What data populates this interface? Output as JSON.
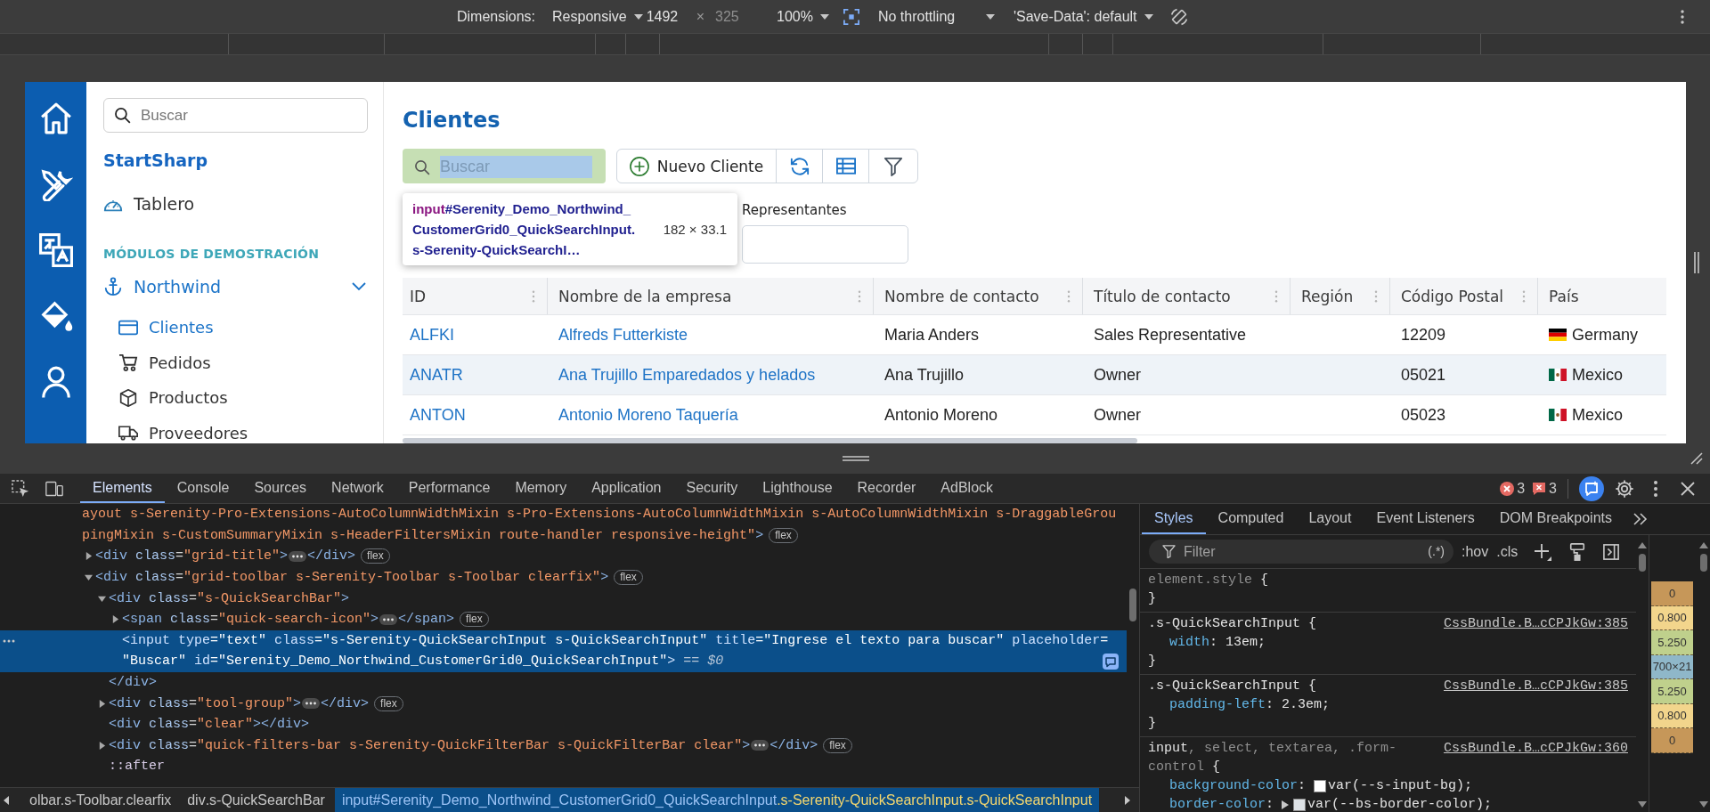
{
  "device_toolbar": {
    "dimensions_label": "Dimensions:",
    "preset": "Responsive",
    "width": {
      "value": "1492"
    },
    "times": "×",
    "height": {
      "placeholder": "325"
    },
    "zoom": "100%",
    "throttling": "No throttling",
    "save_data": "'Save-Data': default"
  },
  "sidebar": {
    "search": {
      "placeholder": "Buscar"
    },
    "brand": "StartSharp",
    "items": [
      {
        "kind": "gauge",
        "label": "Tablero",
        "selected": false
      }
    ],
    "section": "MÓDULOS DE DEMOSTRACIÓN",
    "module": {
      "label": "Northwind",
      "expanded": true,
      "children": [
        {
          "kind": "card",
          "label": "Clientes",
          "selected": true
        },
        {
          "kind": "cart",
          "label": "Pedidos",
          "selected": false
        },
        {
          "kind": "cube",
          "label": "Productos",
          "selected": false
        },
        {
          "kind": "truck",
          "label": "Proveedores",
          "selected": false
        }
      ]
    }
  },
  "page": {
    "title": "Clientes",
    "quick_search": {
      "placeholder": "Buscar"
    },
    "toolbar_buttons": [
      {
        "kind": "add",
        "label": "Nuevo Cliente"
      },
      {
        "kind": "refresh"
      },
      {
        "kind": "columns"
      },
      {
        "kind": "filter"
      }
    ],
    "inspect_tooltip": {
      "tag": "input",
      "selector": "#Serenity_Demo_Northwind_CustomerGrid0_QuickSearchInput.s-Serenity-QuickSearchI…",
      "size": "182 × 33.1"
    },
    "quick_filters": [
      {
        "label": "Representantes"
      }
    ],
    "grid": {
      "columns": [
        "ID",
        "Nombre de la empresa",
        "Nombre de contacto",
        "Título de contacto",
        "Región",
        "Código Postal",
        "País"
      ],
      "rows": [
        {
          "kind": "de",
          "id": "ALFKI",
          "company": "Alfreds Futterkiste",
          "contact": "Maria Anders",
          "contact_title": "Sales Representative",
          "postal_code": "12209",
          "country": "Germany"
        },
        {
          "kind": "mx",
          "id": "ANATR",
          "company": "Ana Trujillo Emparedados y helados",
          "contact": "Ana Trujillo",
          "contact_title": "Owner",
          "postal_code": "05021",
          "country": "Mexico"
        },
        {
          "kind": "mx",
          "id": "ANTON",
          "company": "Antonio Moreno Taquería",
          "contact": "Antonio Moreno",
          "contact_title": "Owner",
          "postal_code": "05023",
          "country": "Mexico"
        }
      ]
    }
  },
  "devtools": {
    "tabs": [
      {
        "label": "Elements",
        "selected": true
      },
      {
        "label": "Console",
        "selected": false
      },
      {
        "label": "Sources",
        "selected": false
      },
      {
        "label": "Network",
        "selected": false
      },
      {
        "label": "Performance",
        "selected": false
      },
      {
        "label": "Memory",
        "selected": false
      },
      {
        "label": "Application",
        "selected": false
      },
      {
        "label": "Security",
        "selected": false
      },
      {
        "label": "Lighthouse",
        "selected": false
      },
      {
        "label": "Recorder",
        "selected": false
      },
      {
        "label": "AdBlock",
        "selected": false
      }
    ],
    "errors": "3",
    "issues": "3",
    "tree": [
      {
        "selected": false,
        "lines": [
          [
            {
              "kind": "value",
              "text": "ayout s-Serenity-Pro-Extensions-AutoColumnWidthMixin s-Pro-Extensions-AutoColumnWidthMixin s-AutoColumnWidthMixin s-DraggableGrou"
            }
          ],
          [
            {
              "kind": "value",
              "text": "pingMixin s-CustomSummaryMixin s-HeaderFiltersMixin route-handler responsive-height\""
            },
            {
              "kind": "tag",
              "text": ">"
            }
          ]
        ],
        "badge": "flex",
        "children": [
          {
            "expanded": false,
            "selected": false,
            "lines": [
              [
                {
                  "kind": "tag",
                  "text": "<div"
                },
                {
                  "kind": "attr",
                  "text": " class"
                },
                {
                  "kind": "plain",
                  "text": "="
                },
                {
                  "kind": "value",
                  "text": "\"grid-title\""
                },
                {
                  "kind": "tag",
                  "text": ">"
                }
              ]
            ],
            "close": [
              {
                "kind": "tag",
                "text": "</div>"
              }
            ],
            "badge": "flex"
          },
          {
            "expanded": true,
            "selected": false,
            "lines": [
              [
                {
                  "kind": "tag",
                  "text": "<div"
                },
                {
                  "kind": "attr",
                  "text": " class"
                },
                {
                  "kind": "plain",
                  "text": "="
                },
                {
                  "kind": "value",
                  "text": "\"grid-toolbar s-Serenity-Toolbar s-Toolbar clearfix\""
                },
                {
                  "kind": "tag",
                  "text": ">"
                }
              ]
            ],
            "badge": "flex",
            "children": [
              {
                "expanded": true,
                "selected": false,
                "lines": [
                  [
                    {
                      "kind": "tag",
                      "text": "<div"
                    },
                    {
                      "kind": "attr",
                      "text": " class"
                    },
                    {
                      "kind": "plain",
                      "text": "="
                    },
                    {
                      "kind": "value",
                      "text": "\"s-QuickSearchBar\""
                    },
                    {
                      "kind": "tag",
                      "text": ">"
                    }
                  ]
                ],
                "children": [
                  {
                    "expanded": false,
                    "selected": false,
                    "lines": [
                      [
                        {
                          "kind": "tag",
                          "text": "<span"
                        },
                        {
                          "kind": "attr",
                          "text": " class"
                        },
                        {
                          "kind": "plain",
                          "text": "="
                        },
                        {
                          "kind": "value",
                          "text": "\"quick-search-icon\""
                        },
                        {
                          "kind": "tag",
                          "text": ">"
                        }
                      ]
                    ],
                    "close": [
                      {
                        "kind": "tag",
                        "text": "</span>"
                      }
                    ],
                    "badge": "flex"
                  },
                  {
                    "selected": true,
                    "lines": [
                      [
                        {
                          "kind": "tag",
                          "text": "<input"
                        },
                        {
                          "kind": "attr",
                          "text": " type"
                        },
                        {
                          "kind": "plain",
                          "text": "="
                        },
                        {
                          "kind": "value",
                          "text": "\"text\""
                        },
                        {
                          "kind": "attr",
                          "text": " class"
                        },
                        {
                          "kind": "plain",
                          "text": "="
                        },
                        {
                          "kind": "value",
                          "text": "\"s-Serenity-QuickSearchInput s-QuickSearchInput\""
                        },
                        {
                          "kind": "attr",
                          "text": " title"
                        },
                        {
                          "kind": "plain",
                          "text": "="
                        },
                        {
                          "kind": "value",
                          "text": "\"Ingrese el texto para buscar\""
                        },
                        {
                          "kind": "attr",
                          "text": " placeholder"
                        },
                        {
                          "kind": "plain",
                          "text": "="
                        }
                      ],
                      [
                        {
                          "kind": "value",
                          "text": "\"Buscar\""
                        },
                        {
                          "kind": "attr",
                          "text": " id"
                        },
                        {
                          "kind": "plain",
                          "text": "="
                        },
                        {
                          "kind": "value",
                          "text": "\"Serenity_Demo_Northwind_CustomerGrid0_QuickSearchInput\""
                        },
                        {
                          "kind": "tag",
                          "text": ">"
                        }
                      ]
                    ],
                    "console_ref": "== $0"
                  }
                ],
                "close": [
                  {
                    "kind": "tag",
                    "text": "</div>"
                  }
                ]
              },
              {
                "expanded": false,
                "selected": false,
                "lines": [
                  [
                    {
                      "kind": "tag",
                      "text": "<div"
                    },
                    {
                      "kind": "attr",
                      "text": " class"
                    },
                    {
                      "kind": "plain",
                      "text": "="
                    },
                    {
                      "kind": "value",
                      "text": "\"tool-group\""
                    },
                    {
                      "kind": "tag",
                      "text": ">"
                    }
                  ]
                ],
                "close": [
                  {
                    "kind": "tag",
                    "text": "</div>"
                  }
                ],
                "badge": "flex"
              },
              {
                "selected": false,
                "lines": [
                  [
                    {
                      "kind": "tag",
                      "text": "<div"
                    },
                    {
                      "kind": "attr",
                      "text": " class"
                    },
                    {
                      "kind": "plain",
                      "text": "="
                    },
                    {
                      "kind": "value",
                      "text": "\"clear\""
                    },
                    {
                      "kind": "tag",
                      "text": "></div>"
                    }
                  ]
                ]
              },
              {
                "expanded": false,
                "selected": false,
                "lines": [
                  [
                    {
                      "kind": "tag",
                      "text": "<div"
                    },
                    {
                      "kind": "attr",
                      "text": " class"
                    },
                    {
                      "kind": "plain",
                      "text": "="
                    },
                    {
                      "kind": "value",
                      "text": "\"quick-filters-bar s-Serenity-QuickFilterBar s-QuickFilterBar clear\""
                    },
                    {
                      "kind": "tag",
                      "text": ">"
                    }
                  ]
                ],
                "close": [
                  {
                    "kind": "tag",
                    "text": "</div>"
                  }
                ],
                "badge": "flex"
              },
              {
                "selected": false,
                "lines": [
                  [
                    {
                      "kind": "pseudo",
                      "text": "::after"
                    }
                  ]
                ]
              }
            ]
          }
        ]
      }
    ],
    "breadcrumbs": [
      {
        "selected": false,
        "parts": [
          {
            "kind": "class",
            "text": "olbar.s-Toolbar.clearfix"
          }
        ]
      },
      {
        "selected": false,
        "parts": [
          {
            "kind": "tag",
            "text": "div"
          },
          {
            "kind": "class",
            "text": ".s-QuickSearchBar"
          }
        ]
      },
      {
        "selected": true,
        "parts": [
          {
            "kind": "tag",
            "text": "input"
          },
          {
            "kind": "id",
            "text": "#Serenity_Demo_Northwind_CustomerGrid0_QuickSearchInput"
          },
          {
            "kind": "class",
            "text": ".s-Serenity-QuickSearchInput.s-QuickSearchInput"
          }
        ]
      }
    ],
    "styles_tabs": [
      {
        "label": "Styles",
        "selected": true
      },
      {
        "label": "Computed",
        "selected": false
      },
      {
        "label": "Layout",
        "selected": false
      },
      {
        "label": "Event Listeners",
        "selected": false
      },
      {
        "label": "DOM Breakpoints",
        "selected": false
      }
    ],
    "filter": {
      "placeholder": "Filter"
    },
    "regex_toggle": "(.*)",
    "state_buttons": [
      ":hov",
      ".cls"
    ],
    "rules": [
      {
        "selectors": [
          {
            "text": "element.style",
            "matched": false
          }
        ],
        "open": "{",
        "close": "}"
      },
      {
        "selectors": [
          {
            "text": ".s-QuickSearchInput",
            "matched": true
          }
        ],
        "open": "{",
        "source": "CssBundle.B…cCPJkGw:385",
        "declarations": [
          {
            "property": "width",
            "colon": ": ",
            "value": "13em;"
          }
        ],
        "close": "}"
      },
      {
        "selectors": [
          {
            "text": ".s-QuickSearchInput",
            "matched": true
          }
        ],
        "open": "{",
        "source": "CssBundle.B…cCPJkGw:385",
        "declarations": [
          {
            "property": "padding-left",
            "colon": ": ",
            "value": "2.3em;"
          }
        ],
        "close": "}"
      },
      {
        "selectors": [
          {
            "text": "input",
            "matched": true
          },
          {
            "text": ", select, textarea, .form-control",
            "matched": false
          }
        ],
        "open": "{",
        "source": "CssBundle.B…cCPJkGw:360",
        "declarations": [
          {
            "property": "background-color",
            "colon": ": ",
            "color": "#ffffff",
            "value": "var(--s-input-bg);"
          },
          {
            "property": "border-color",
            "colon": ": ",
            "expanded": false,
            "color": "#dee2e6",
            "value": "var(--bs-border-color);"
          }
        ]
      }
    ],
    "box_model": [
      {
        "kind": "margin",
        "text": "0"
      },
      {
        "kind": "border",
        "text": "0.800"
      },
      {
        "kind": "padding",
        "text": "5.250"
      },
      {
        "kind": "content",
        "text": "700×21"
      },
      {
        "kind": "padding",
        "text": "5.250"
      },
      {
        "kind": "border",
        "text": "0.800"
      },
      {
        "kind": "margin",
        "text": "0"
      }
    ]
  }
}
